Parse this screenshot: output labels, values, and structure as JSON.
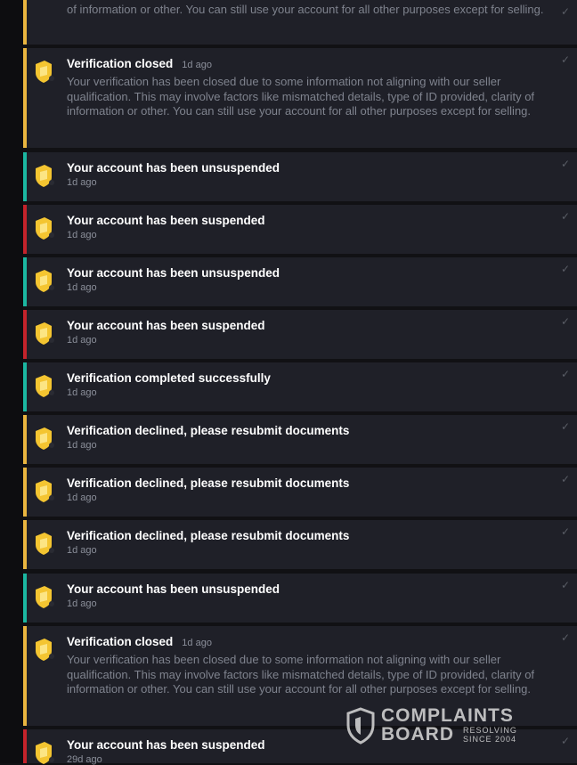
{
  "colors": {
    "card_bg": "#1f2028",
    "yellow_stripe": "#e9b53f",
    "teal_stripe": "#1bb7a1",
    "red_stripe": "#c4232b",
    "title_text": "#ffffff",
    "muted_text": "#8b8f9a"
  },
  "notifications": [
    {
      "title": "",
      "time": "",
      "body": "of information or other. You can still use your account for all other purposes except for selling.",
      "status": "yellow"
    },
    {
      "title": "Verification closed",
      "time": "1d ago",
      "body": "Your verification has been closed due to some information not aligning with our seller qualification. This may involve factors like mismatched details, type of ID provided, clarity of information or other. You can still use your account for all other purposes except for selling.",
      "status": "yellow"
    },
    {
      "title": "Your account has been unsuspended",
      "time": "1d ago",
      "status": "teal"
    },
    {
      "title": "Your account has been suspended",
      "time": "1d ago",
      "status": "red"
    },
    {
      "title": "Your account has been unsuspended",
      "time": "1d ago",
      "status": "teal"
    },
    {
      "title": "Your account has been suspended",
      "time": "1d ago",
      "status": "red"
    },
    {
      "title": "Verification completed successfully",
      "time": "1d ago",
      "status": "teal"
    },
    {
      "title": "Verification declined, please resubmit documents",
      "time": "1d ago",
      "status": "yellow"
    },
    {
      "title": "Verification declined, please resubmit documents",
      "time": "1d ago",
      "status": "yellow"
    },
    {
      "title": "Verification declined, please resubmit documents",
      "time": "1d ago",
      "status": "yellow"
    },
    {
      "title": "Your account has been unsuspended",
      "time": "1d ago",
      "status": "teal"
    },
    {
      "title": "Verification closed",
      "time": "1d ago",
      "body": "Your verification has been closed due to some information not aligning with our seller qualification. This may involve factors like mismatched details, type of ID provided, clarity of information or other. You can still use your account for all other purposes except for selling.",
      "status": "yellow"
    },
    {
      "title": "Your account has been suspended",
      "time": "29d ago",
      "status": "red"
    }
  ],
  "icons": {
    "notification": "shield-badge-icon",
    "read": "check-icon"
  },
  "watermark": {
    "line1": "COMPLAINTS",
    "line2": "BOARD",
    "tag1": "RESOLVING",
    "tag2": "SINCE 2004"
  }
}
